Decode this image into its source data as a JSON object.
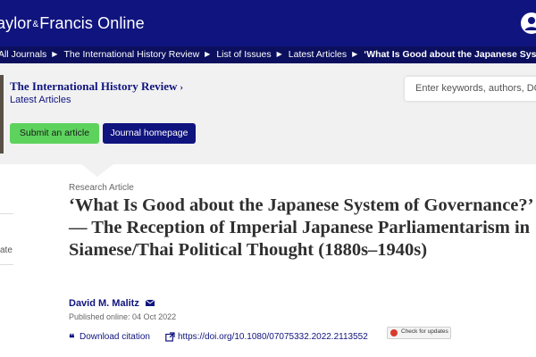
{
  "header": {
    "logo_main": "aylor",
    "logo_amp": "&",
    "logo_rest": "Francis Online"
  },
  "breadcrumb": {
    "items": [
      "All Journals",
      "The International History Review",
      "List of Issues",
      "Latest Articles"
    ],
    "current": "‘What Is Good about the Japanese System ..."
  },
  "journal": {
    "title": "The International History Review",
    "chevron": "›",
    "subtitle": "Latest Articles",
    "submit_label": "Submit an article",
    "homepage_label": "Journal homepage"
  },
  "search": {
    "placeholder": "Enter keywords, authors, DOI,"
  },
  "sidebar": {
    "partial_text": "ate"
  },
  "article": {
    "type": "Research Article",
    "title": "‘What Is Good about the Japanese System of Governance?’ — The Reception of Imperial Japanese Parliamentarism in Siamese/Thai Political Thought (1880s–1940s)",
    "author": "David M. Malitz",
    "published": "Published online: 04 Oct 2022",
    "quote_glyph": "❝",
    "download_label": "Download citation",
    "doi": "https://doi.org/10.1080/07075332.2022.2113552",
    "check_updates": "Check for updates"
  },
  "colors": {
    "brand_navy": "#10147e",
    "breadcrumb_bg": "#0b0f5e",
    "submit_green": "#5dd35d",
    "band_gray": "#f1f1f1"
  },
  "icons": {
    "account": "user-circle-icon",
    "mail": "envelope-icon",
    "citation": "quote-icon",
    "doi": "link-icon",
    "crossmark": "crossmark-icon"
  }
}
